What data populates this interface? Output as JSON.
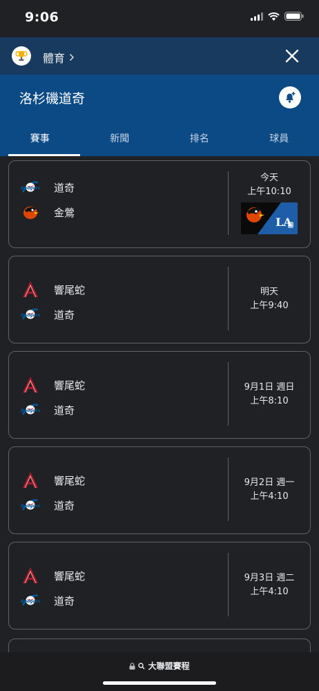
{
  "status": {
    "time": "9:06"
  },
  "header": {
    "breadcrumb": "體育",
    "team_title": "洛杉磯道奇"
  },
  "tabs": [
    {
      "label": "賽事",
      "active": true
    },
    {
      "label": "新聞",
      "active": false
    },
    {
      "label": "排名",
      "active": false
    },
    {
      "label": "球員",
      "active": false
    }
  ],
  "games": [
    {
      "team1": "道奇",
      "team1_icon": "dodgers-logo",
      "team2": "金鶯",
      "team2_icon": "orioles-logo",
      "day": "今天",
      "time": "上午10:10",
      "has_thumbnail": true
    },
    {
      "team1": "響尾蛇",
      "team1_icon": "diamondbacks-logo",
      "team2": "道奇",
      "team2_icon": "dodgers-logo",
      "day": "明天",
      "time": "上午9:40"
    },
    {
      "team1": "響尾蛇",
      "team1_icon": "diamondbacks-logo",
      "team2": "道奇",
      "team2_icon": "dodgers-logo",
      "day": "9月1日 週日",
      "time": "上午8:10"
    },
    {
      "team1": "響尾蛇",
      "team1_icon": "diamondbacks-logo",
      "team2": "道奇",
      "team2_icon": "dodgers-logo",
      "day": "9月2日 週一",
      "time": "上午4:10"
    },
    {
      "team1": "響尾蛇",
      "team1_icon": "diamondbacks-logo",
      "team2": "道奇",
      "team2_icon": "dodgers-logo",
      "day": "9月3日 週二",
      "time": "上午4:10"
    }
  ],
  "bottom": {
    "url": "大聯盟賽程"
  },
  "colors": {
    "header_dark": "#183a5e",
    "header_blue": "#0b4a85",
    "card_border": "#5f6368",
    "dbacks_red": "#a71930",
    "orioles_orange": "#df4601",
    "dodgers_blue": "#005a9c"
  }
}
